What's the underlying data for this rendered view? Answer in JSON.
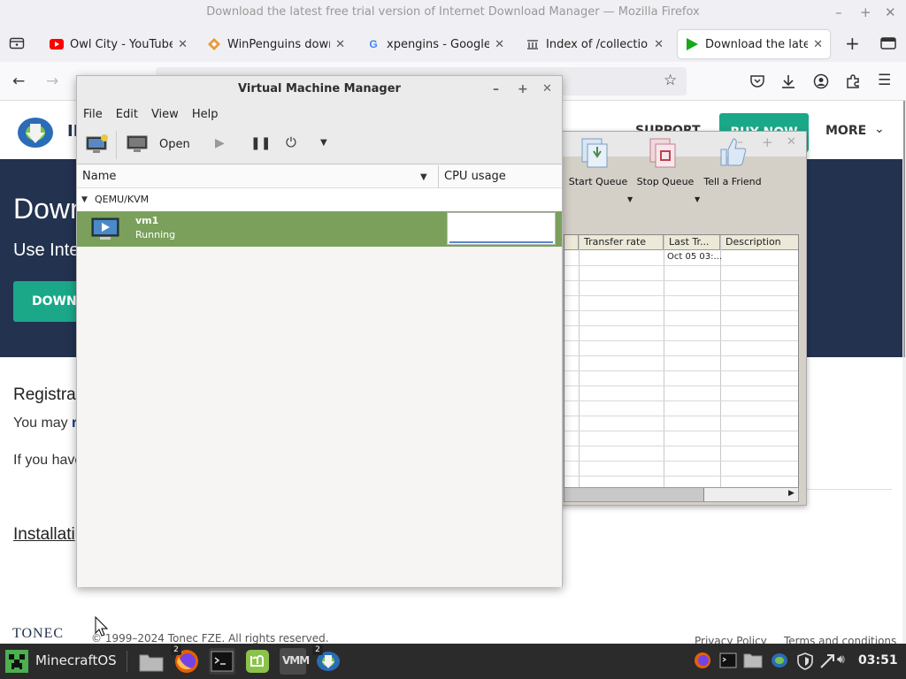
{
  "firefox": {
    "title": "Download the latest free trial version of Internet Download Manager — Mozilla Firefox",
    "tabs": [
      {
        "label": "Owl City - YouTube",
        "icon": "youtube-icon"
      },
      {
        "label": "WinPenguins downlo",
        "icon": "winpenguins-icon"
      },
      {
        "label": "xpengins - Google Se",
        "icon": "google-icon"
      },
      {
        "label": "Index of /collection/",
        "icon": "archive-icon"
      },
      {
        "label": "Download the latest",
        "icon": "idm-favicon"
      }
    ]
  },
  "site": {
    "logo_text": "IN",
    "nav": {
      "support": "SUPPORT",
      "buy": "BUY NOW",
      "more": "MORE"
    },
    "hero": {
      "title": "Down",
      "subtitle": "Use Inte",
      "button": "DOWNL"
    },
    "body": {
      "registration_heading": "Registra",
      "registration_text_start": "You may",
      "registration_text_link": "r",
      "line2": "If you have",
      "installation_heading": "Installati",
      "footer_logo": "TONEC",
      "copyright": "© 1999–2024 Tonec FZE. All rights reserved.",
      "privacy": "Privacy Policy",
      "terms": "Terms and conditions"
    }
  },
  "idm": {
    "buttons": [
      {
        "label": "Start Queue",
        "icon": "start-queue-icon"
      },
      {
        "label": "Stop Queue",
        "icon": "stop-queue-icon"
      },
      {
        "label": "Tell a Friend",
        "icon": "thumbs-up-icon"
      }
    ],
    "columns": [
      "Transfer rate",
      "Last Tr...",
      "Description"
    ],
    "rows": [
      {
        "last_try": "Oct 05 03:..."
      }
    ]
  },
  "vmm": {
    "title": "Virtual Machine Manager",
    "menu": [
      "File",
      "Edit",
      "View",
      "Help"
    ],
    "toolbar": {
      "open": "Open"
    },
    "columns": {
      "name": "Name",
      "cpu": "CPU usage"
    },
    "group": "QEMU/KVM",
    "vm": {
      "name": "vm1",
      "status": "Running",
      "cpu_usage": 0
    }
  },
  "taskbar": {
    "start": "MinecraftOS",
    "badges": {
      "firefox": "2",
      "idm": "2"
    },
    "clock": "03:51"
  }
}
